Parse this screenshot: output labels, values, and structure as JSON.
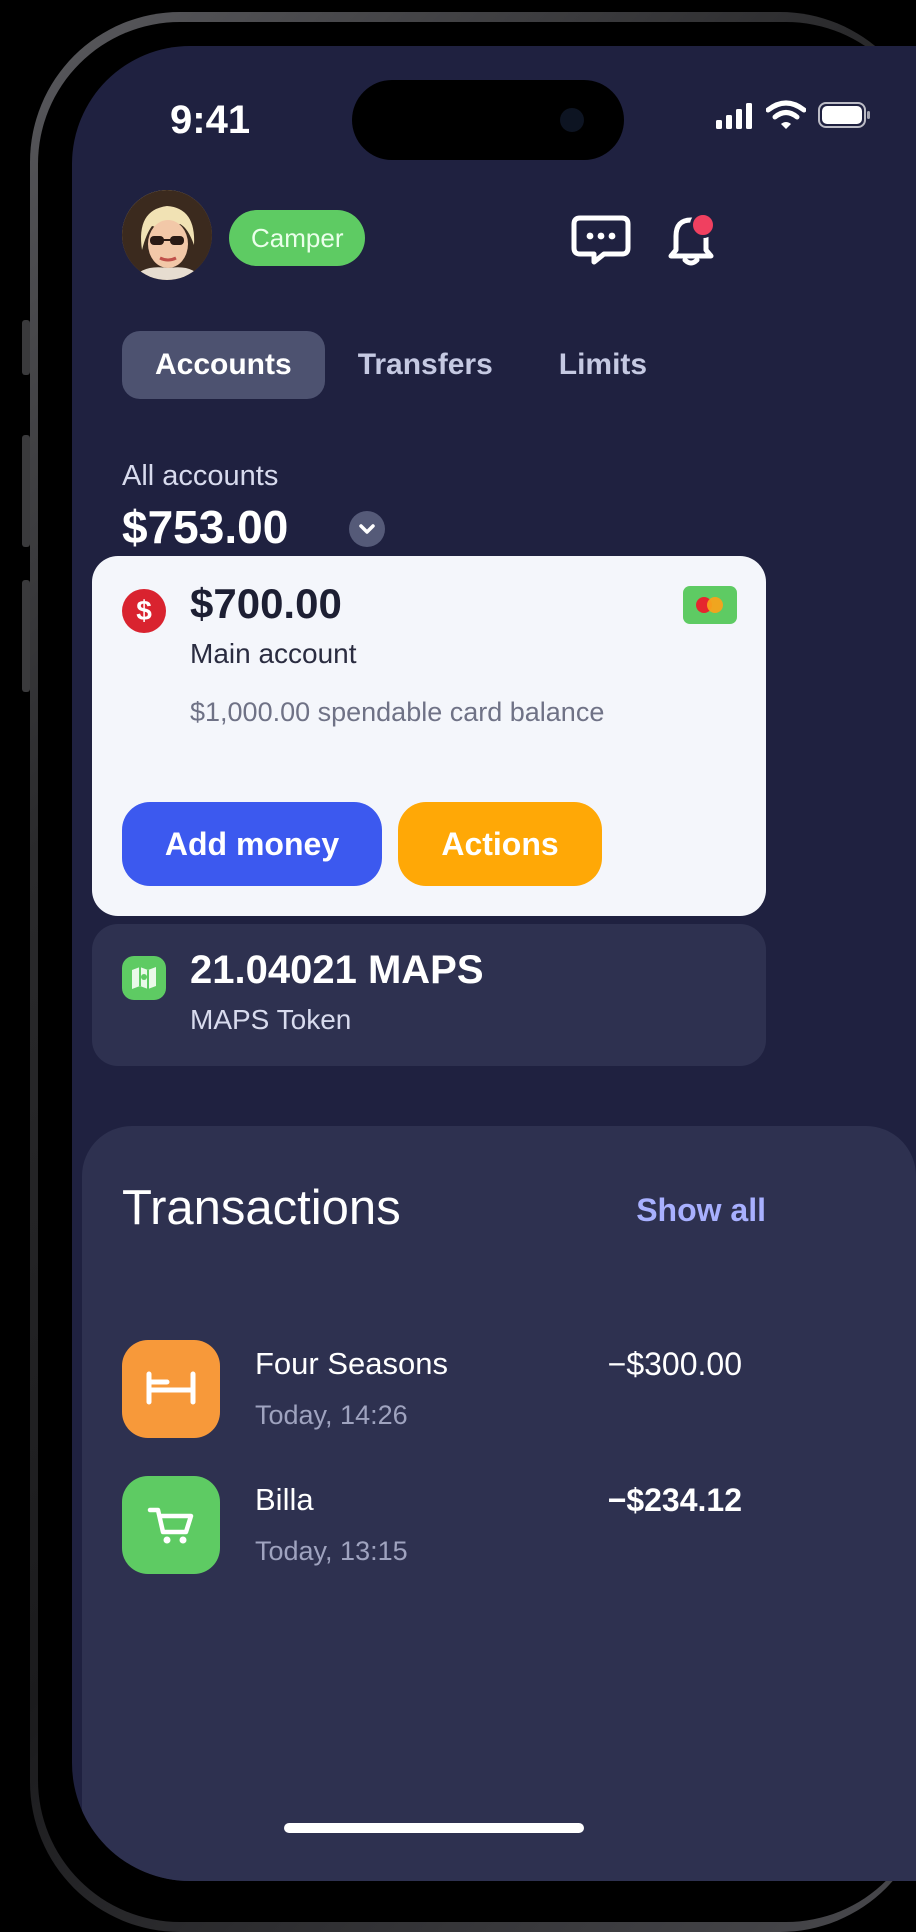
{
  "status_bar": {
    "time": "9:41"
  },
  "header": {
    "badge_label": "Camper",
    "icons": {
      "avatar": "user-avatar",
      "messages": "chat-bubble-icon",
      "notifications": "bell-icon"
    },
    "notification_dot_color": "#f04060"
  },
  "tabs": [
    {
      "label": "Accounts",
      "active": true
    },
    {
      "label": "Transfers",
      "active": false
    },
    {
      "label": "Limits",
      "active": false
    }
  ],
  "balance": {
    "label": "All accounts",
    "value": "$753.00"
  },
  "main_account": {
    "icon": "dollar-icon",
    "amount": "$700.00",
    "name": "Main account",
    "spendable": "$1,000.00 spendable card balance",
    "add_money_label": "Add money",
    "actions_label": "Actions"
  },
  "token_account": {
    "icon": "map-token-icon",
    "amount": "21.04021 MAPS",
    "name": "MAPS Token"
  },
  "transactions": {
    "title": "Transactions",
    "show_all_label": "Show all",
    "items": [
      {
        "name": "Four Seasons",
        "time": "Today, 14:26",
        "amount": "−$300.00",
        "icon": "bed-icon",
        "icon_color": "#f7993a"
      },
      {
        "name": "Billa",
        "time": "Today, 13:15",
        "amount": "−$234.12",
        "icon": "shopping-cart-icon",
        "icon_color": "#5ecb63"
      }
    ]
  },
  "colors": {
    "background": "#1f2140",
    "panel": "#2e3150",
    "accent_blue": "#3c59ef",
    "accent_orange": "#ffa806",
    "accent_green": "#5ecb63",
    "link": "#a8b0ff"
  }
}
